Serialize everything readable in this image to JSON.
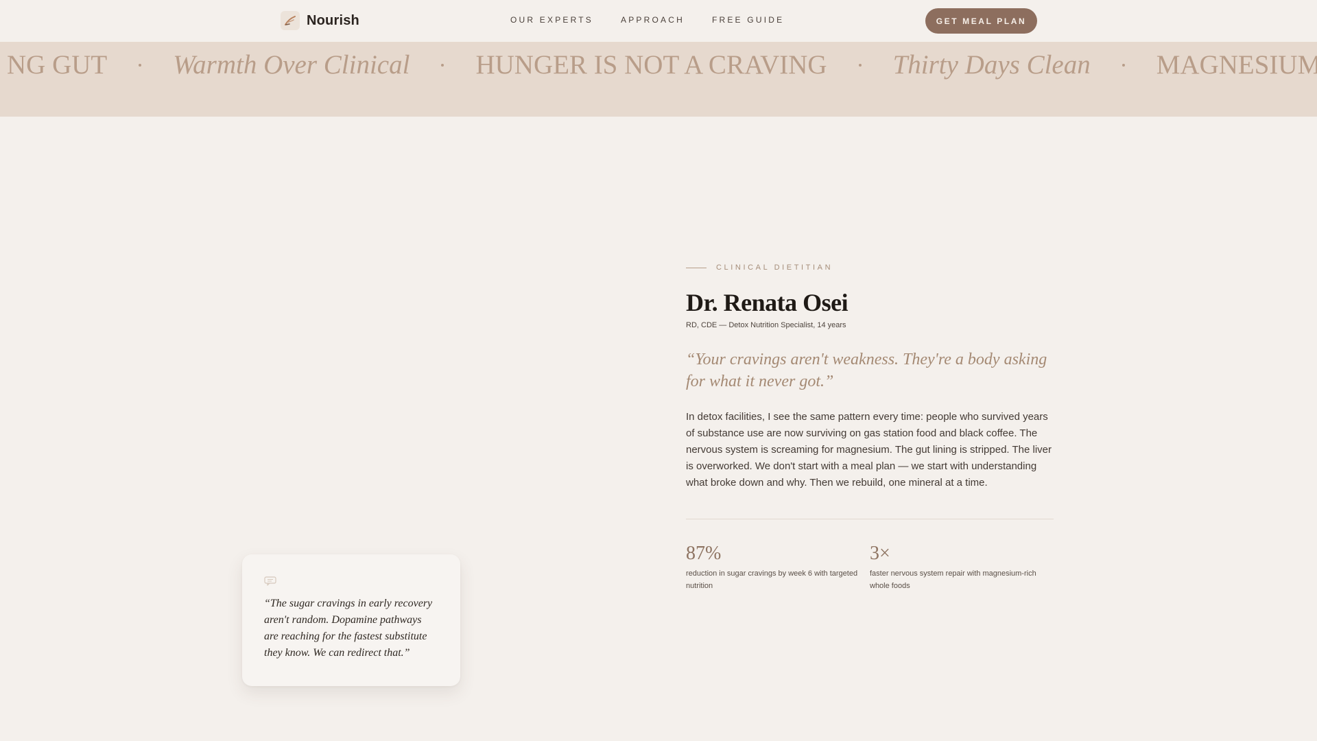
{
  "header": {
    "brand": "Nourish",
    "nav": [
      "OUR EXPERTS",
      "APPROACH",
      "FREE GUIDE"
    ],
    "cta": "GET MEAL PLAN"
  },
  "marquee": {
    "items": [
      {
        "text": "NG GUT",
        "style": "caps"
      },
      {
        "text": "Warmth Over Clinical",
        "style": "italic"
      },
      {
        "text": "HUNGER IS NOT A CRAVING",
        "style": "caps"
      },
      {
        "text": "Thirty Days Clean",
        "style": "italic"
      },
      {
        "text": "MAGNESIUM FOR TH",
        "style": "caps"
      }
    ]
  },
  "quote_card": {
    "icon": "chat-bubble-icon",
    "text": "“The sugar cravings in early recovery aren't random. Dopamine pathways are reaching for the fastest substitute they know. We can redirect that.”"
  },
  "profile": {
    "eyebrow": "CLINICAL DIETITIAN",
    "name": "Dr. Renata Osei",
    "credentials": "RD, CDE — Detox Nutrition Specialist, 14 years",
    "pull_quote": "“Your cravings aren't weakness. They're a body asking for what it never got.”",
    "bio": "In detox facilities, I see the same pattern every time: people who survived years of substance use are now surviving on gas station food and black coffee. The nervous system is screaming for magnesium. The gut lining is stripped. The liver is overworked. We don't start with a meal plan — we start with understanding what broke down and why. Then we rebuild, one mineral at a time.",
    "stats": [
      {
        "value": "87%",
        "label": "reduction in sugar cravings by week 6 with targeted nutrition"
      },
      {
        "value": "3×",
        "label": "faster nervous system repair with magnesium-rich whole foods"
      }
    ]
  },
  "colors": {
    "background": "#f4f0ec",
    "accent": "#8d6e5e",
    "marquee_band": "#e6d9ce",
    "quote_tan": "#a48973"
  }
}
